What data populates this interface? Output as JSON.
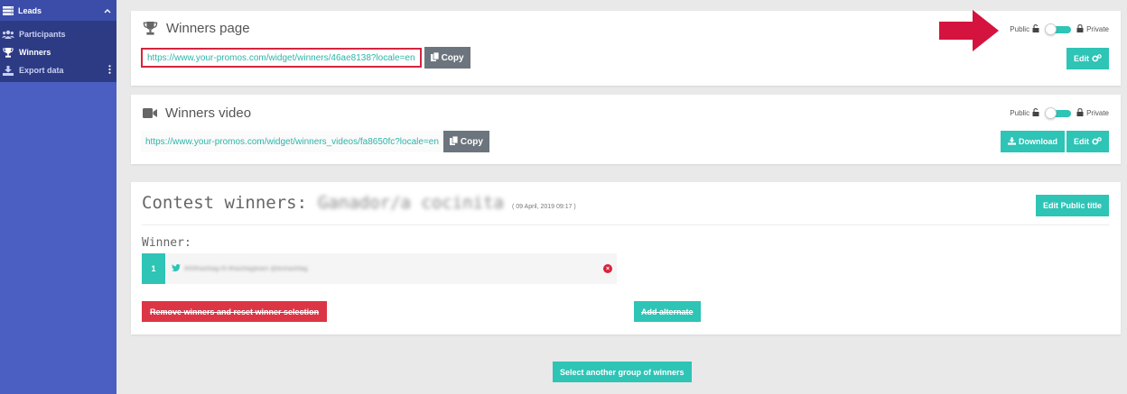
{
  "sidebar": {
    "header": {
      "label": "Leads",
      "icon": "server-icon",
      "chevron": "chevron-up-icon"
    },
    "items": [
      {
        "label": "Participants",
        "icon": "users-icon",
        "active": false
      },
      {
        "label": "Winners",
        "icon": "trophy-icon",
        "active": true
      },
      {
        "label": "Export data",
        "icon": "download-icon",
        "active": false
      }
    ]
  },
  "winners_page": {
    "title": "Winners page",
    "url": "https://www.your-promos.com/widget/winners/46ae8138?locale=en",
    "copy_label": "Copy",
    "public_label": "Public",
    "private_label": "Private",
    "edit_label": "Edit"
  },
  "winners_video": {
    "title": "Winners video",
    "url": "https://www.your-promos.com/widget/winners_videos/fa8650fc?locale=en",
    "copy_label": "Copy",
    "public_label": "Public",
    "private_label": "Private",
    "download_label": "Download",
    "edit_label": "Edit"
  },
  "contest": {
    "title": "Contest winners:",
    "name": "Ganador/a cocinita",
    "date": "( 09 April, 2019 09:17 )",
    "edit_title_label": "Edit Public title",
    "winner_label": "Winner:",
    "winners": [
      {
        "rank": "1",
        "text": "#IIIIIhashtag-III-#hashtagteam @texhashtag"
      }
    ],
    "remove_label": "Remove winners and reset winner selection",
    "add_alternate_label": "Add alternate"
  },
  "select_group_label": "Select another group of winners",
  "colors": {
    "teal": "#2ec4b6",
    "red": "#dc3545",
    "sidebar": "#4a5fc1",
    "highlight": "#d4243f"
  }
}
